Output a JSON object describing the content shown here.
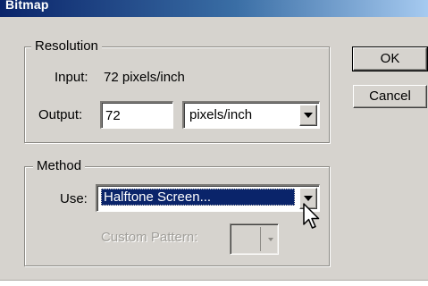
{
  "window": {
    "title": "Bitmap"
  },
  "resolution": {
    "legend": "Resolution",
    "input_label": "Input:",
    "input_value": "72 pixels/inch",
    "output_label": "Output:",
    "output_value": "72",
    "output_unit": "pixels/inch"
  },
  "method": {
    "legend": "Method",
    "use_label": "Use:",
    "use_value": "Halftone Screen...",
    "custom_pattern_label": "Custom Pattern:"
  },
  "buttons": {
    "ok": "OK",
    "cancel": "Cancel"
  },
  "icons": {
    "dropdown": "chevron-down-icon",
    "cursor": "mouse-pointer-icon"
  },
  "colors": {
    "dialog_bg": "#d6d3ce",
    "selection": "#0a246a",
    "titlebar": "#0a246a"
  }
}
